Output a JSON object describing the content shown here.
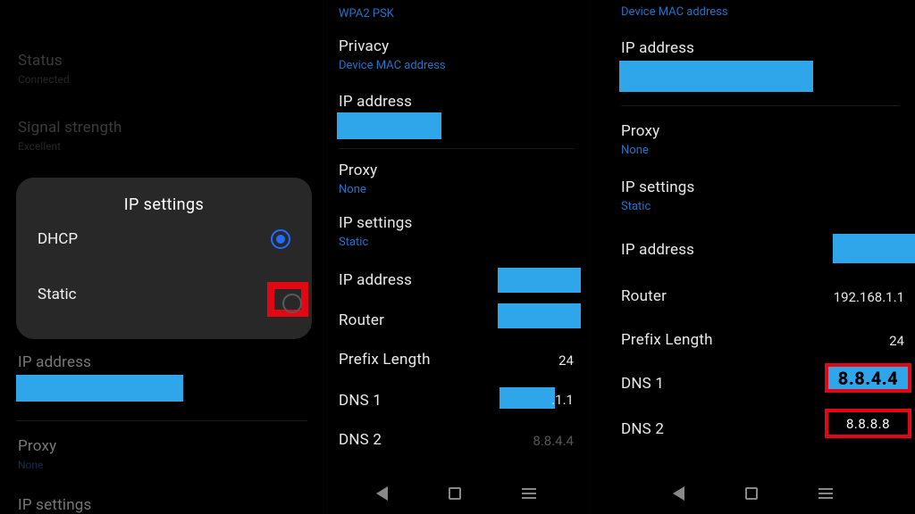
{
  "panelA": {
    "status_label": "Status",
    "status_value": "Connected",
    "signal_label": "Signal strength",
    "signal_value": "Excellent",
    "modal": {
      "title": "IP settings",
      "options": {
        "dhcp": "DHCP",
        "static": "Static"
      }
    },
    "ip_label": "IP address",
    "proxy_label": "Proxy",
    "proxy_value": "None",
    "ipsettings_label": "IP settings"
  },
  "panelB": {
    "security_value": "WPA2 PSK",
    "privacy_label": "Privacy",
    "privacy_value": "Device MAC address",
    "ip_label": "IP address",
    "proxy_label": "Proxy",
    "proxy_value": "None",
    "ipsettings_label": "IP settings",
    "ipsettings_value": "Static",
    "ip2_label": "IP address",
    "router_label": "Router",
    "prefix_label": "Prefix Length",
    "prefix_value": "24",
    "dns1_label": "DNS 1",
    "dns1_suffix": ".1.1",
    "dns2_label": "DNS 2",
    "dns2_value": "8.8.4.4"
  },
  "panelC": {
    "mac": "Device MAC address",
    "ip_label": "IP address",
    "proxy_label": "Proxy",
    "proxy_value": "None",
    "ipsettings_label": "IP settings",
    "ipsettings_value": "Static",
    "ip2_label": "IP address",
    "router_label": "Router",
    "router_value": "192.168.1.1",
    "prefix_label": "Prefix Length",
    "prefix_value": "24",
    "dns1_label": "DNS 1",
    "dns1_value": "8.8.4.4",
    "dns2_label": "DNS 2",
    "dns2_value": "8.8.8.8"
  }
}
